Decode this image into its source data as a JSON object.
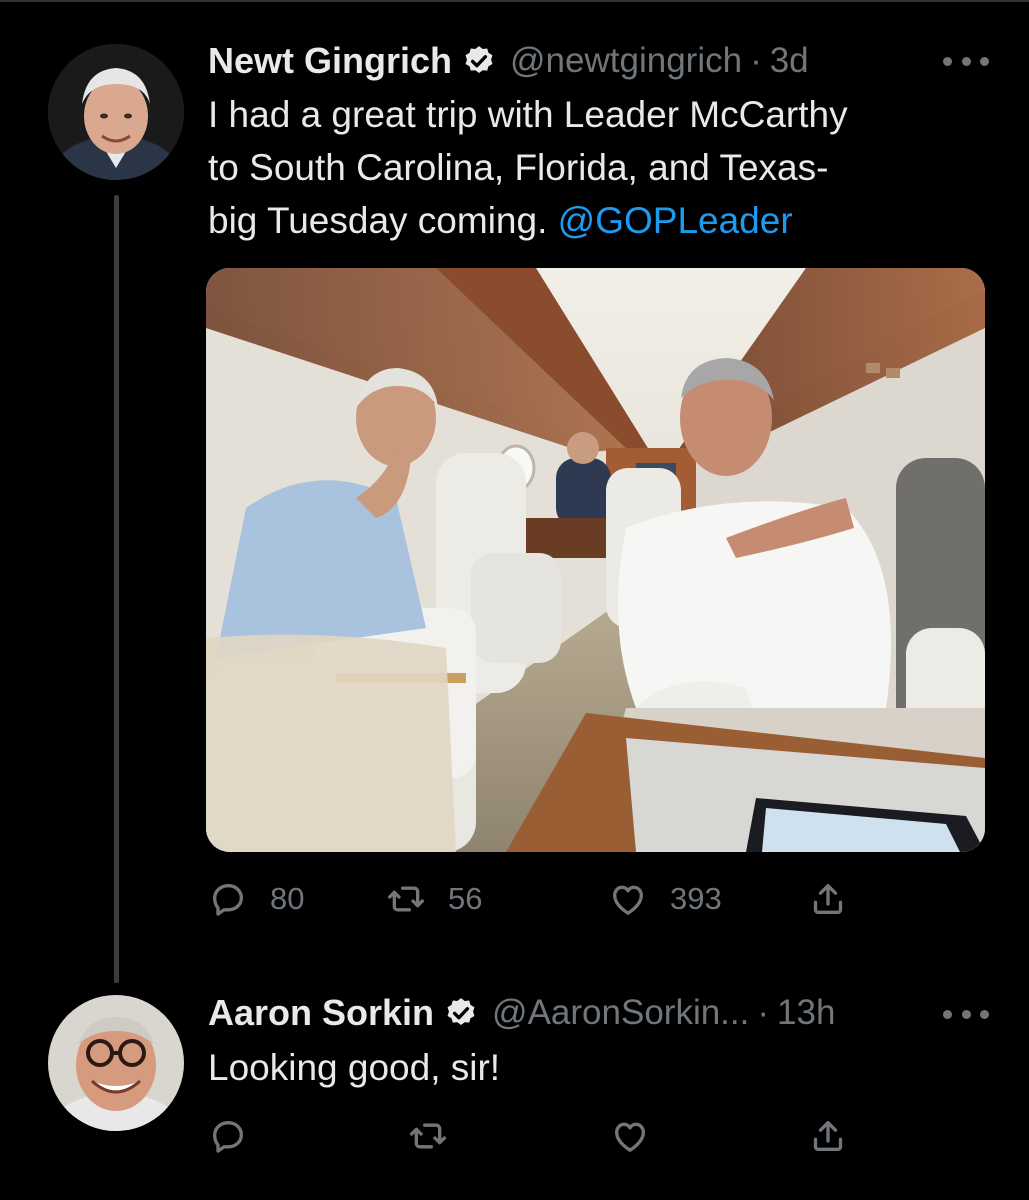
{
  "thread": [
    {
      "author": {
        "name": "Newt Gingrich",
        "handle": "@newtgingrich",
        "verified": true
      },
      "time": "3d",
      "text": {
        "lines": [
          "I had a great trip with Leader McCarthy",
          "to South Carolina, Florida, and Texas-"
        ],
        "line3": "big Tuesday coming.",
        "mention": "@GOPLeader"
      },
      "has_photo": true,
      "actions": {
        "replies": "80",
        "retweets": "56",
        "likes": "393"
      }
    },
    {
      "author": {
        "name": "Aaron Sorkin",
        "handle": "@AaronSorkin...",
        "verified": true
      },
      "time": "13h",
      "text": {
        "body": "Looking good, sir!"
      },
      "actions": {
        "replies": "",
        "retweets": "",
        "likes": ""
      }
    }
  ],
  "separator": "·",
  "colors": {
    "background": "#000000",
    "text": "#e7e9ea",
    "muted": "#71767b",
    "link": "#1d9bf0"
  },
  "icons": [
    "verified-badge-icon",
    "more-icon",
    "reply-icon",
    "retweet-icon",
    "like-icon",
    "share-icon"
  ]
}
